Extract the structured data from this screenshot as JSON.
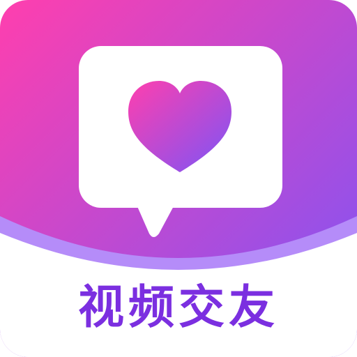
{
  "icon": {
    "name": "视频交友",
    "glyph": "heart-chat-bubble",
    "colors": {
      "gradient_start": "#FF3FAE",
      "gradient_end": "#7B55F7",
      "wave": "#B58CF9",
      "label": "#7B2FE0",
      "card_bg": "#FFFFFF"
    }
  }
}
